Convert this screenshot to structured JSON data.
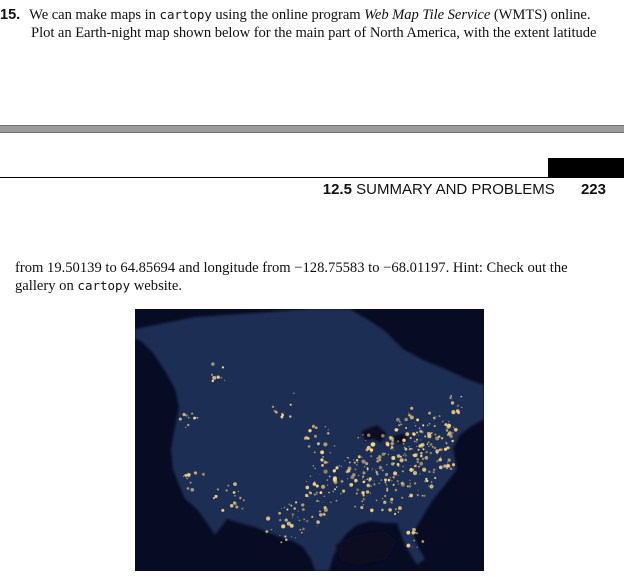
{
  "problem": {
    "number": "15.",
    "line1_a": "We can make maps in ",
    "line1_code": "cartopy",
    "line1_b": " using the online program ",
    "line1_italic": "Web Map Tile Service",
    "line1_c": " (WMTS) online.",
    "line2": "Plot an Earth-night map shown below for the main part of North America, with the extent latitude"
  },
  "header": {
    "section_number": "12.5",
    "section_title": "SUMMARY AND PROBLEMS",
    "page_number": "223"
  },
  "continuation": {
    "line1": "from 19.50139 to 64.85694 and longitude from −128.75583 to −68.01197. Hint: Check out the",
    "line2_a": "gallery on ",
    "line2_code": "cartopy",
    "line2_b": " website."
  },
  "figure": {
    "ocean_color": "#070c24",
    "land_color": "#1f2d52",
    "light_color": "#ffd98a"
  }
}
